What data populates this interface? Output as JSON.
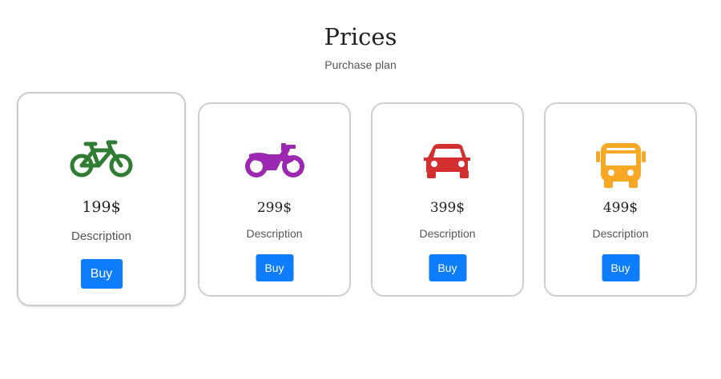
{
  "header": {
    "title": "Prices",
    "subtitle": "Purchase plan"
  },
  "plans": [
    {
      "icon": "bicycle-icon",
      "color": "#2e7d32",
      "price": "199$",
      "description": "Description",
      "button_label": "Buy"
    },
    {
      "icon": "motorcycle-icon",
      "color": "#9c27b0",
      "price": "299$",
      "description": "Description",
      "button_label": "Buy"
    },
    {
      "icon": "car-icon",
      "color": "#d32f2f",
      "price": "399$",
      "description": "Description",
      "button_label": "Buy"
    },
    {
      "icon": "bus-icon",
      "color": "#f9a825",
      "price": "499$",
      "description": "Description",
      "button_label": "Buy"
    }
  ],
  "colors": {
    "button": "#0d7dfb",
    "card_border": "#cfcfcf"
  }
}
